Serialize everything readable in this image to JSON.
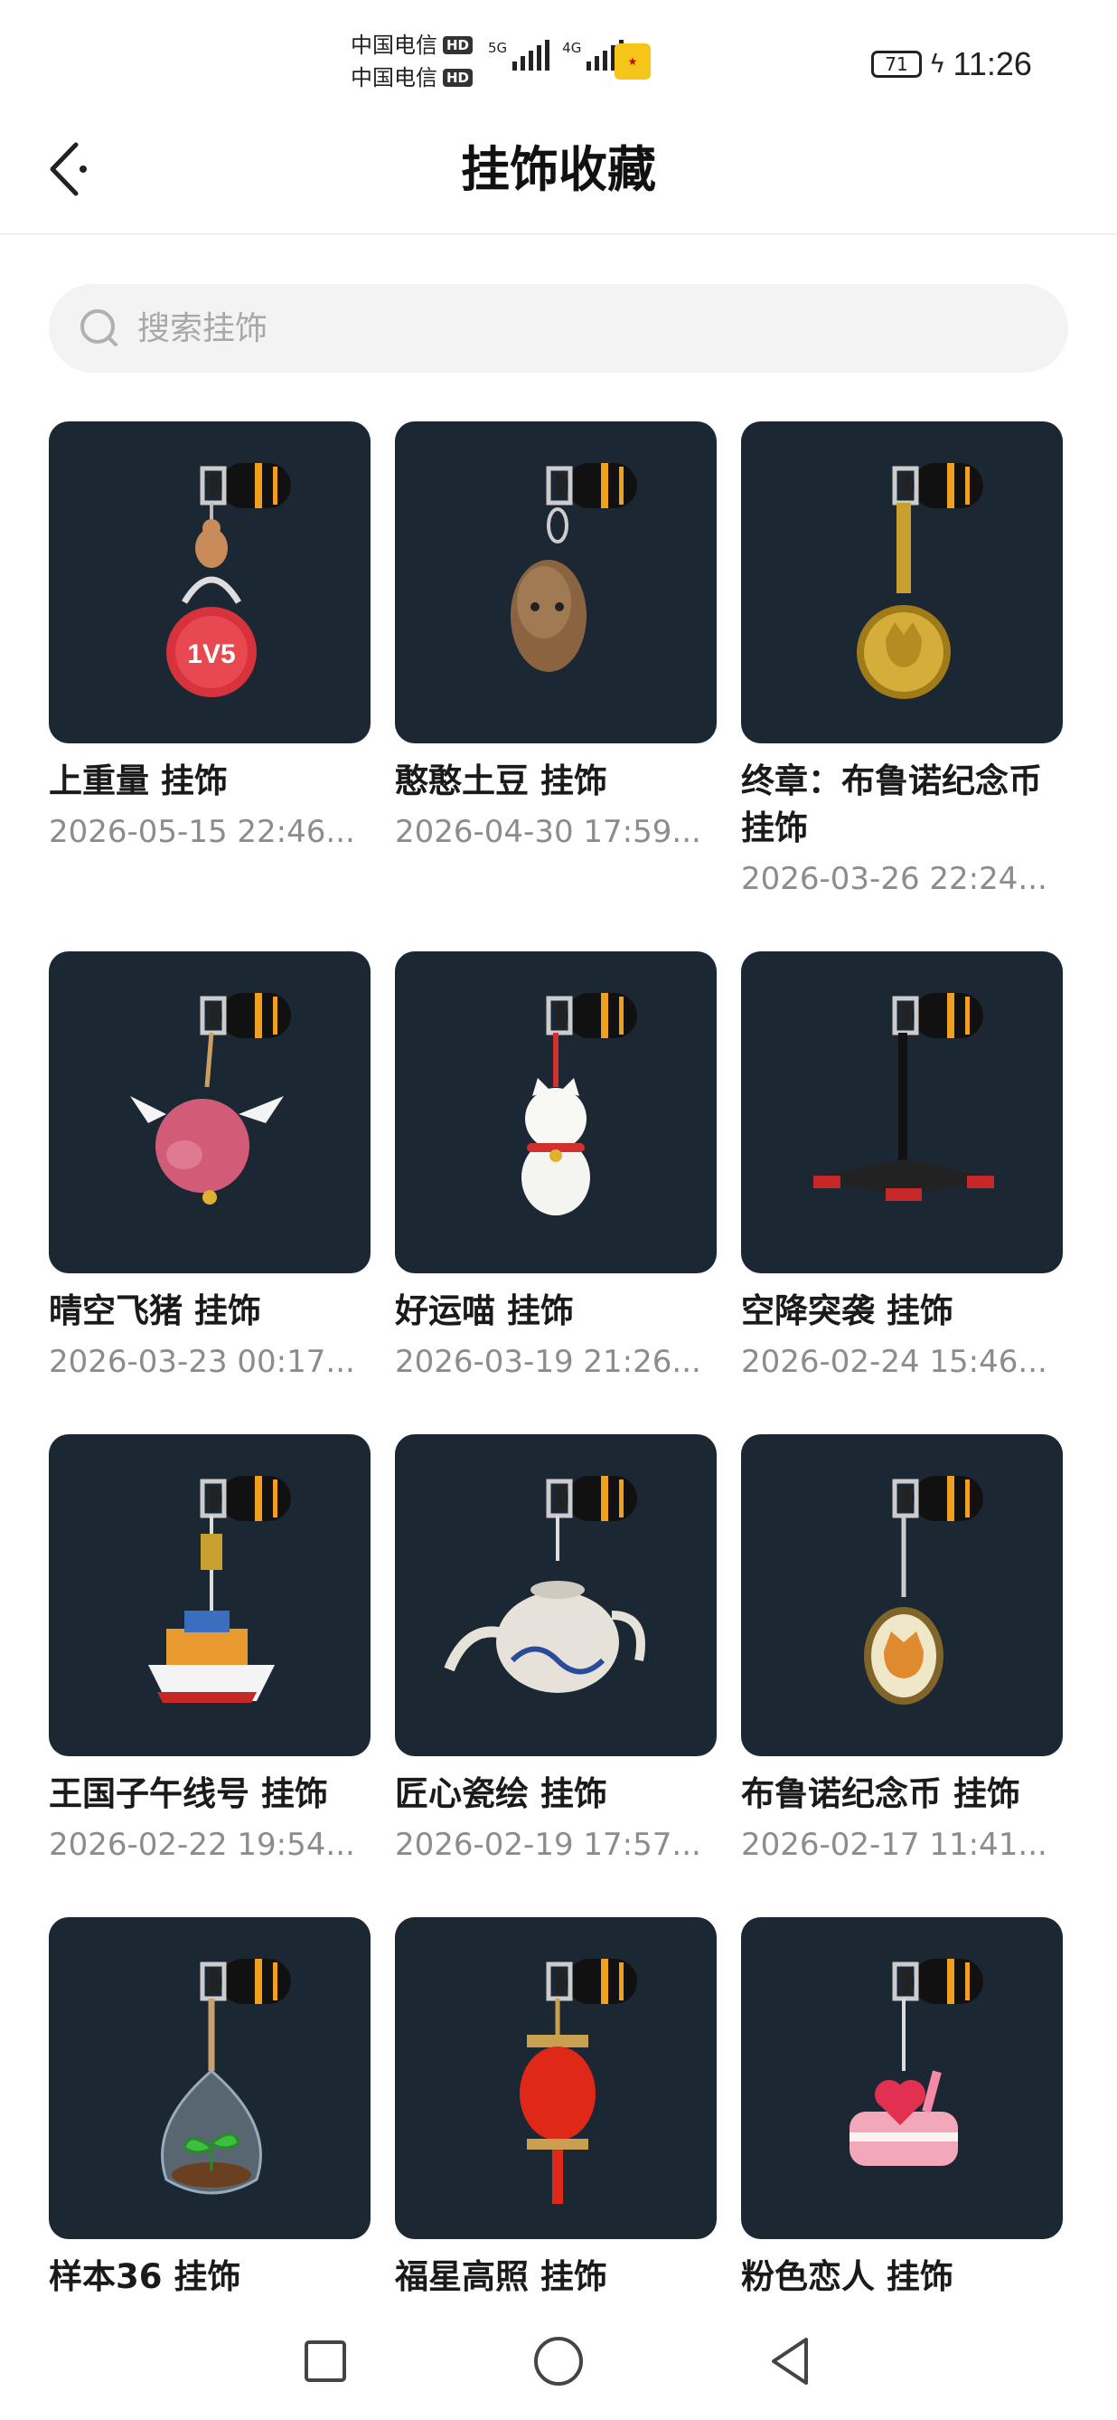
{
  "status_bar": {
    "carrier1": "中国电信",
    "carrier2": "中国电信",
    "hd_badge": "HD",
    "net1": "5G",
    "net2": "4G",
    "battery": "71",
    "time": "11:26"
  },
  "header": {
    "title": "挂饰收藏"
  },
  "search": {
    "placeholder": "搜索挂饰"
  },
  "items": [
    {
      "name": " 上重量 挂饰",
      "date": "2026-05-15 22:46...",
      "kind": "kettlebell"
    },
    {
      "name": "憨憨土豆 挂饰",
      "date": "2026-04-30 17:59...",
      "kind": "potato"
    },
    {
      "name": "终章：布鲁诺纪念币 挂饰",
      "date": "2026-03-26 22:24...",
      "kind": "gold-coin"
    },
    {
      "name": "晴空飞猪 挂饰",
      "date": "2026-03-23 00:17...",
      "kind": "flying-pig"
    },
    {
      "name": "好运喵 挂饰",
      "date": "2026-03-19 21:26...",
      "kind": "lucky-cat"
    },
    {
      "name": "空降突袭 挂饰",
      "date": "2026-02-24 15:46...",
      "kind": "drone"
    },
    {
      "name": "王国子午线号 挂饰",
      "date": "2026-02-22 19:54...",
      "kind": "ship"
    },
    {
      "name": "匠心瓷绘 挂饰",
      "date": "2026-02-19 17:57...",
      "kind": "teapot"
    },
    {
      "name": "布鲁诺纪念币 挂饰",
      "date": "2026-02-17 11:41...",
      "kind": "corgi-coin"
    },
    {
      "name": "样本36 挂饰",
      "date": "",
      "kind": "terrarium"
    },
    {
      "name": "福星高照 挂饰",
      "date": "",
      "kind": "lantern"
    },
    {
      "name": "粉色恋人 挂饰",
      "date": "",
      "kind": "cake"
    }
  ],
  "kettlebell_label": "1V5",
  "colors": {
    "thumb_bg": "#1c2734",
    "accent_orange": "#f0a020"
  }
}
